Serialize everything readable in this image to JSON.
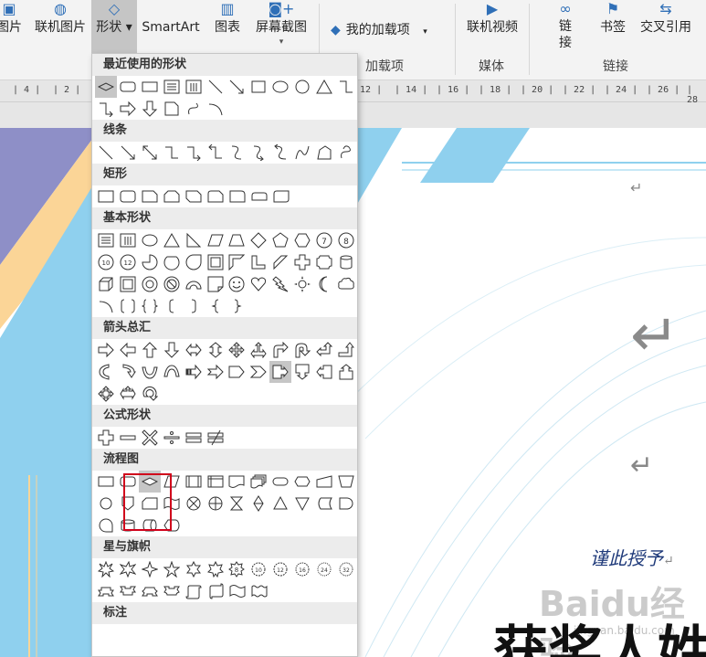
{
  "ribbon": {
    "buttons": [
      {
        "id": "pictures",
        "label": "图片",
        "icon": "picture-icon"
      },
      {
        "id": "online-pictures",
        "label": "联机图片",
        "icon": "online-picture-icon"
      },
      {
        "id": "shapes",
        "label": "形状",
        "icon": "shapes-icon"
      },
      {
        "id": "smartart",
        "label": "SmartArt",
        "icon": "smartart-icon"
      },
      {
        "id": "chart",
        "label": "图表",
        "icon": "chart-icon"
      },
      {
        "id": "screenshot",
        "label": "屏幕截图",
        "icon": "screenshot-icon"
      },
      {
        "id": "online-video",
        "label": "联机视频",
        "icon": "online-video-icon"
      },
      {
        "id": "link",
        "label": "链接",
        "icon": "link-icon"
      },
      {
        "id": "bookmark",
        "label": "书签",
        "icon": "bookmark-icon"
      },
      {
        "id": "cross-reference",
        "label": "交叉引用",
        "icon": "cross-reference-icon"
      }
    ],
    "addins_label": "我的加载项",
    "groups": {
      "addins": "加载项",
      "media": "媒体",
      "links": "链接"
    }
  },
  "ruler": {
    "ticks": [
      "4",
      "2",
      "12",
      "14",
      "16",
      "18",
      "20",
      "22",
      "24",
      "26",
      "28"
    ]
  },
  "shapes_menu": {
    "recent": "最近使用的形状",
    "lines": "线条",
    "rectangles": "矩形",
    "basic": "基本形状",
    "arrows": "箭头总汇",
    "equation": "公式形状",
    "flowchart": "流程图",
    "stars": "星与旗帜",
    "callouts": "标注"
  },
  "document": {
    "dedication": "谨此授予",
    "title": "获奖人姓",
    "return_mark": "↵"
  },
  "watermark": {
    "text": "Baidu经验",
    "url": "jingyan.baidu.com"
  },
  "colors": {
    "accent": "#2f6fb7",
    "highlight": "#d0021b",
    "stripe_blue": "#8fd0ee",
    "stripe_purple": "#8e8fc7",
    "stripe_orange": "#fbd597"
  }
}
